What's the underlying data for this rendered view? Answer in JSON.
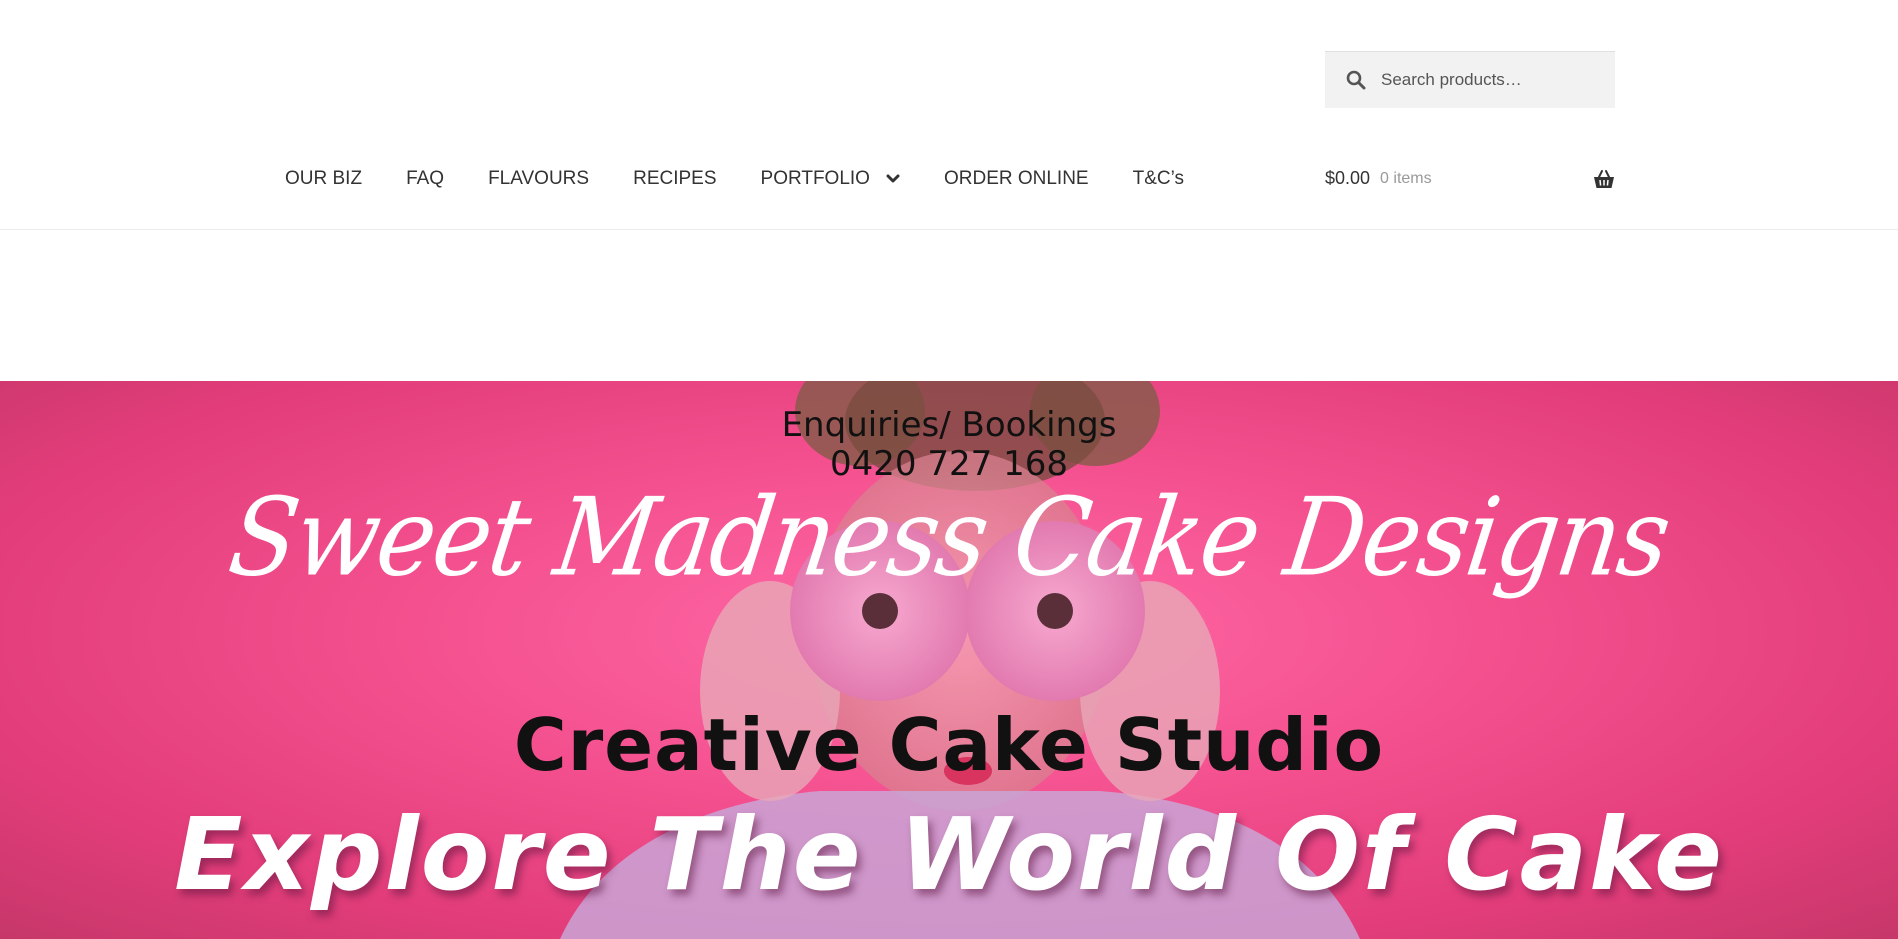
{
  "header": {
    "search": {
      "placeholder": "Search products…",
      "icon": "search-icon"
    },
    "nav": {
      "items": [
        {
          "label": "OUR BIZ"
        },
        {
          "label": "FAQ"
        },
        {
          "label": "FLAVOURS"
        },
        {
          "label": "RECIPES"
        },
        {
          "label": "PORTFOLIO",
          "has_dropdown": true
        },
        {
          "label": "ORDER ONLINE"
        },
        {
          "label": "T&C’s"
        }
      ]
    },
    "cart": {
      "amount": "$0.00",
      "count": "0 items",
      "icon": "basket-icon"
    }
  },
  "hero": {
    "enquiries_line1": "Enquiries/ Bookings",
    "enquiries_line2": "0420 727 168",
    "script_title": "Sweet Madness Cake Designs",
    "studio_heading": "Creative Cake Studio",
    "tagline": "Explore The World Of Cake",
    "colors": {
      "background": "#f4508f",
      "heading_text": "#111111",
      "script_text": "#ffffff"
    }
  }
}
